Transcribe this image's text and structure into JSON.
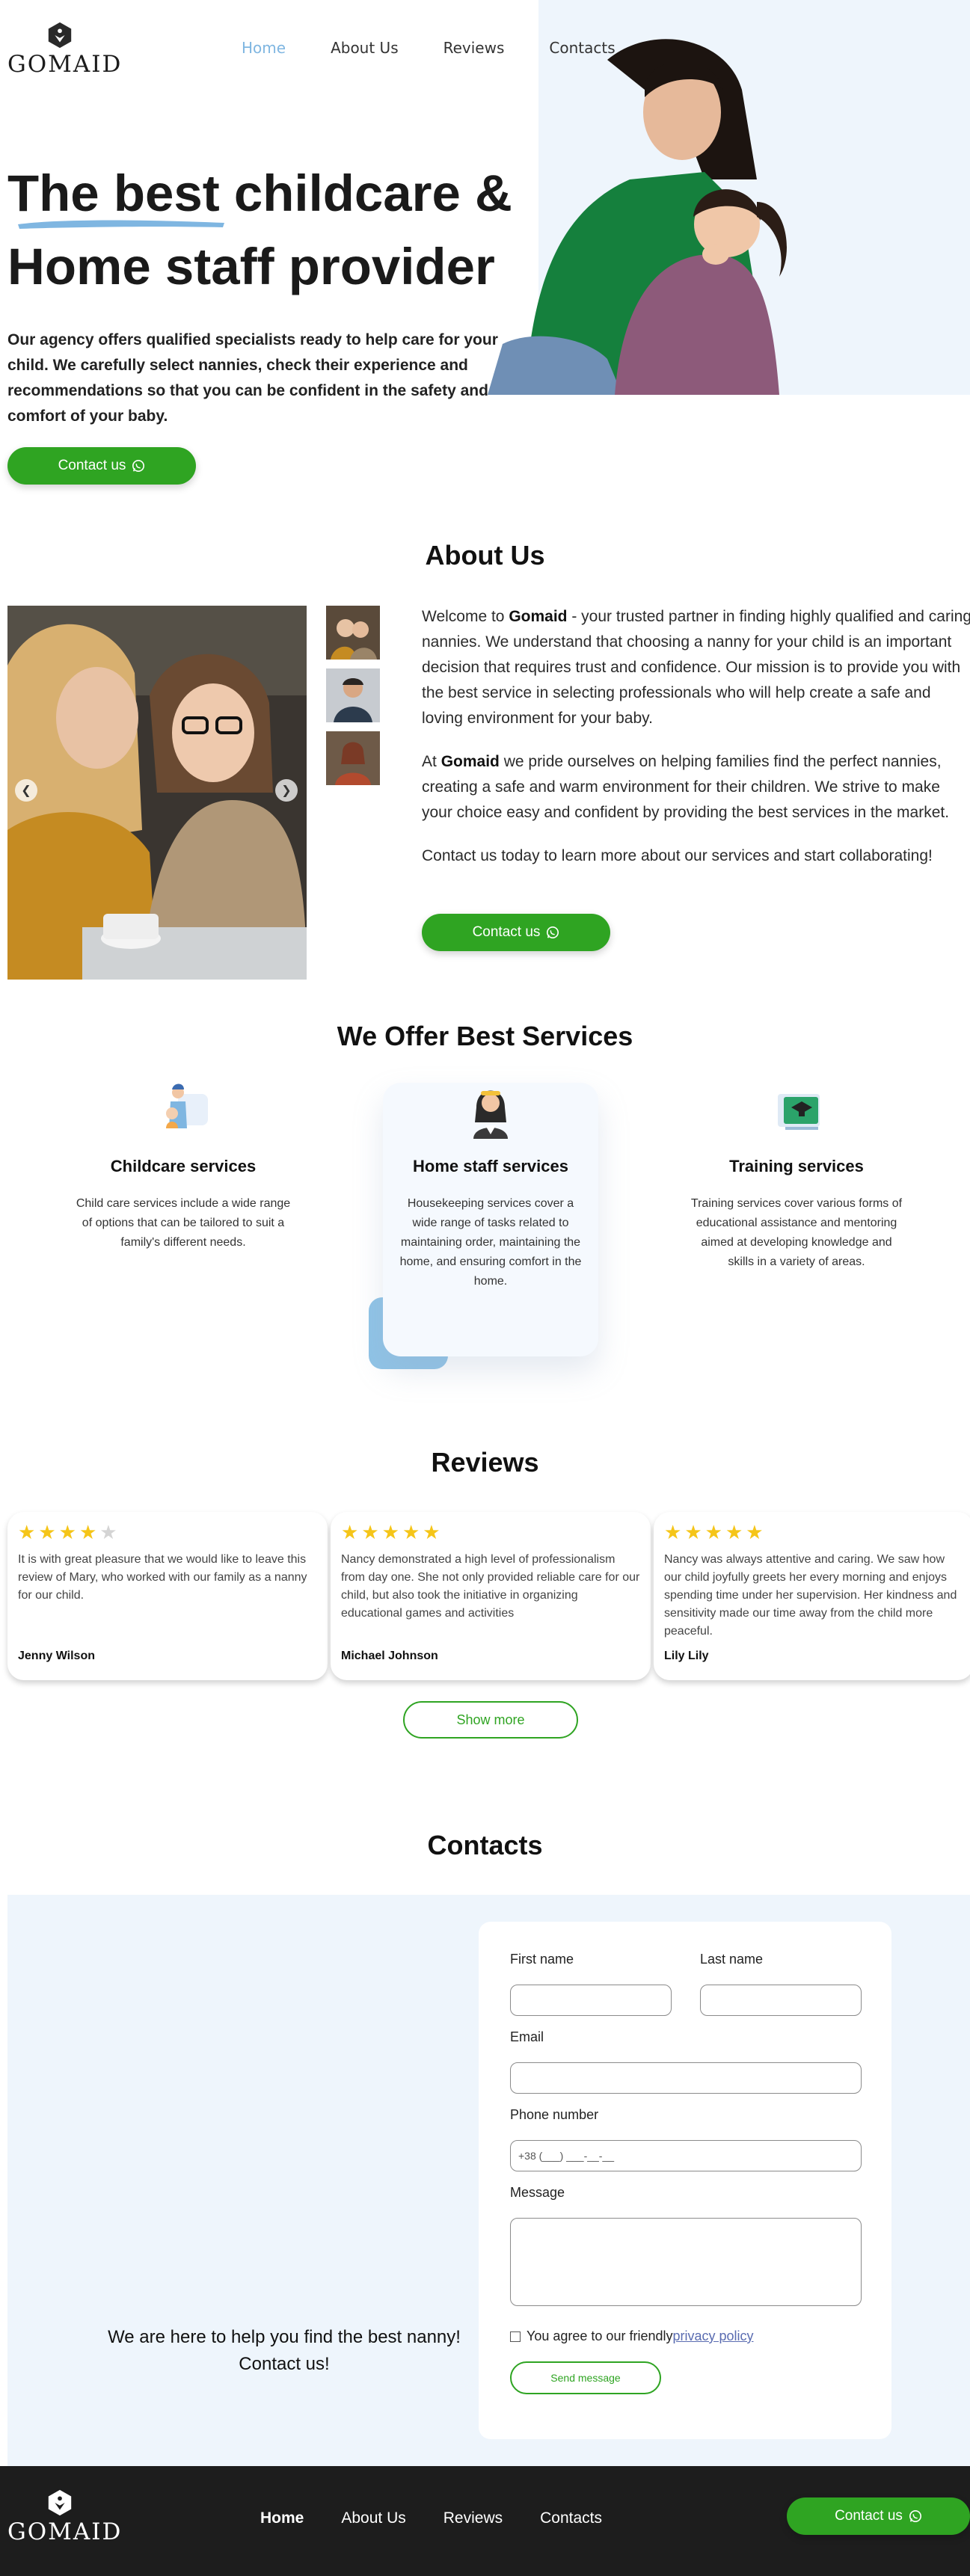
{
  "brand": {
    "name": "GOMAID"
  },
  "nav": {
    "items": [
      {
        "label": "Home",
        "active": true
      },
      {
        "label": "About Us"
      },
      {
        "label": "Reviews"
      },
      {
        "label": "Contacts"
      }
    ]
  },
  "hero": {
    "title_line1": "The best childcare &",
    "title_line2": "Home staff provider",
    "description": "Our agency offers qualified specialists ready to help care for your child. We carefully select nannies, check their experience and recommendations so that you can be confident in the safety and comfort of your baby.",
    "button_label": "Contact us"
  },
  "about": {
    "title": "About Us",
    "p1_prefix": "Welcome to ",
    "p1_brand": "Gomaid",
    "p1_text": " - your trusted partner in finding highly qualified and caring nannies. We understand that choosing a nanny for your child is an important decision that requires trust and confidence. Our mission is to provide you with the best service in selecting professionals who will help create a safe and loving environment for your baby.",
    "p2_prefix": "At ",
    "p2_brand": "Gomaid",
    "p2_text": " we pride ourselves on helping families find the perfect nannies, creating a safe and warm environment for their children. We strive to make your choice easy and confident by providing the best services in the market.",
    "p3": "Contact us today to learn more about our services and start collaborating!",
    "button_label": "Contact us",
    "arrow_left": "❮",
    "arrow_right": "❯"
  },
  "services": {
    "title": "We Offer Best Services",
    "items": [
      {
        "title": "Childcare services",
        "text": "Child care services include a wide range of options that can be tailored to suit a family's different needs."
      },
      {
        "title": "Home staff services",
        "text": "Housekeeping services cover a wide range of tasks related to maintaining order, maintaining the home, and ensuring comfort in the home."
      },
      {
        "title": "Training services",
        "text": "Training services cover various forms of educational assistance and mentoring aimed at developing knowledge and skills in a variety of areas."
      }
    ]
  },
  "reviews": {
    "title": "Reviews",
    "items": [
      {
        "rating": 4,
        "text": "It is with great pleasure that we would like to leave this review of Mary, who worked with our family as a nanny for our child.",
        "author": "Jenny Wilson"
      },
      {
        "rating": 5,
        "text": "Nancy demonstrated a high level of professionalism from day one. She not only provided reliable care for our child, but also took the initiative in organizing educational games and activities",
        "author": "Michael Johnson"
      },
      {
        "rating": 5,
        "text": "Nancy was always attentive and caring. We saw how our child joyfully greets her every morning and enjoys spending time under her supervision. Her kindness and sensitivity made our time away from the child more peaceful.",
        "author": "Lily Lily"
      }
    ],
    "show_more": "Show more"
  },
  "contacts": {
    "title": "Contacts",
    "tagline": "We are here to help you find the best nanny! Contact us!",
    "form": {
      "first_name_label": "First name",
      "last_name_label": "Last name",
      "email_label": "Email",
      "phone_label": "Phone number",
      "phone_placeholder": "+38 (___) ___-__-__",
      "message_label": "Message",
      "agree_prefix": "You agree to our friendly ",
      "agree_link": "privacy policy",
      "send_label": "Send message"
    }
  },
  "footer": {
    "nav": [
      {
        "label": "Home",
        "active": true
      },
      {
        "label": "About Us"
      },
      {
        "label": "Reviews"
      },
      {
        "label": "Contacts"
      }
    ],
    "button_label": "Contact us"
  },
  "colors": {
    "accent_green": "#2fa422",
    "nav_active_blue": "#7fb6e1",
    "light_blue_bg": "#eef5fc",
    "footer_bg": "#1d1d1d",
    "star": "#f5c518"
  },
  "icons": [
    "gomaid-logo-icon",
    "whatsapp-icon",
    "chevron-left-icon",
    "chevron-right-icon",
    "childcare-icon",
    "home-staff-icon",
    "training-icon",
    "star-icon",
    "checkbox-icon"
  ]
}
